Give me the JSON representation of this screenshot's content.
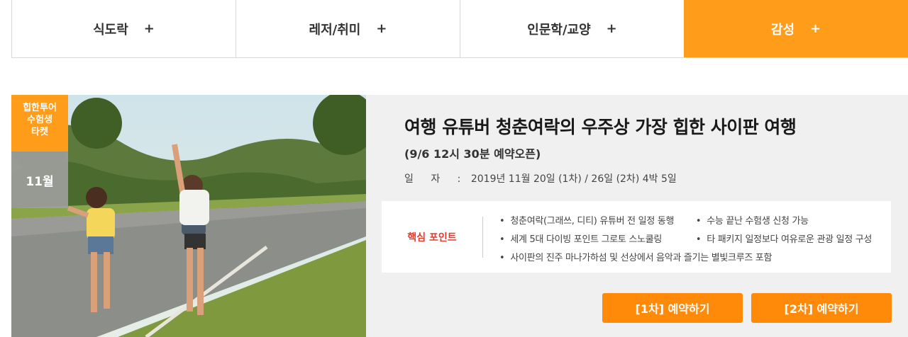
{
  "tabs": [
    {
      "label": "식도락",
      "plus": "+"
    },
    {
      "label": "레저/취미",
      "plus": "+"
    },
    {
      "label": "인문학/교양",
      "plus": "+"
    },
    {
      "label": "감성",
      "plus": "+",
      "active": true
    }
  ],
  "colors": {
    "accent": "#ff9c19",
    "button": "#ff8a0a",
    "point_label": "#e53a2c"
  },
  "card": {
    "badge_lines": [
      "힙한투어",
      "수험생",
      "타켓"
    ],
    "month": "11월",
    "title": "여행 유튜버 청춘여락의 우주상 가장 힙한 사이판 여행",
    "subtitle": "(9/6 12시 30분 예약오픈)",
    "date_label": "일 자 :",
    "date_value": "2019년 11월 20일 (1차) / 26일 (2차)  4박 5일",
    "points_label": "핵심 포인트",
    "points": {
      "row1_a": "청춘여락(그래쓰, 디티) 유튜버 전 일정 동행",
      "row1_b": "수능 끝난 수험생 신청 가능",
      "row2_a": "세계 5대 다이빙 포인트 그로토 스노쿨링",
      "row2_b": "타 패키지 일정보다 여유로운 관광 일정 구성",
      "row3_a": "사이판의 진주 마나가하섬 및 선상에서 음악과 즐기는 별빛크루즈 포함"
    },
    "bullet": "•",
    "button1": "[1차] 예약하기",
    "button2": "[2차] 예약하기"
  }
}
